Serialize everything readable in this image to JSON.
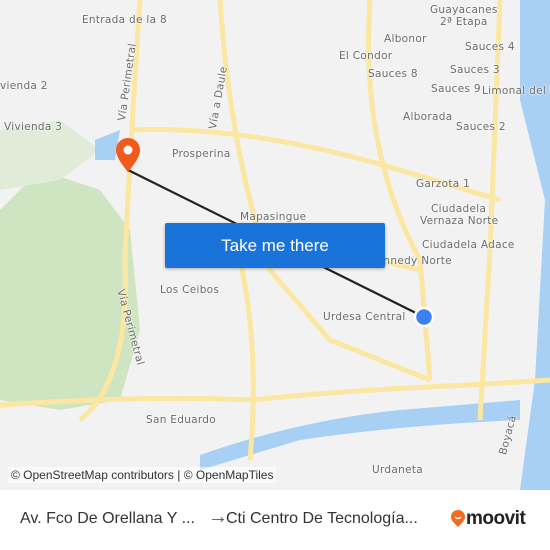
{
  "map": {
    "labels": {
      "entrada": "Entrada de la 8",
      "vivienda2": "vienda 2",
      "vivienda3": "Vivienda 3",
      "via_perimetral_1": "Vía Perimetral",
      "via_perimetral_2": "Vía Perimetral",
      "via_daule": "Vía a Daule",
      "prosperina": "Prosperina",
      "mapasingue": "Mapasingue",
      "los_ceibos": "Los Ceibos",
      "urdesa": "Urdesa Central",
      "san_eduardo": "San Eduardo",
      "urdaneta": "Urdaneta",
      "boyaca": "Boyacá",
      "guayacanes": "Guayacanes",
      "etapa": "2ª Etapa",
      "albonor": "Albonor",
      "el_condor": "El Condor",
      "sauces8": "Sauces 8",
      "sauces4": "Sauces 4",
      "sauces3": "Sauces 3",
      "sauces9": "Sauces 9",
      "limonal": "Limonal del R",
      "alborada": "Alborada",
      "sauces2": "Sauces 2",
      "garzota": "Garzota 1",
      "vernaza1": "Ciudadela",
      "vernaza2": "Vernaza Norte",
      "adace": "Ciudadela Adace",
      "kennedy": "Kennedy Norte"
    },
    "cta_label": "Take me there",
    "attribution": "© OpenStreetMap contributors | © OpenMapTiles",
    "colors": {
      "route": "#222222",
      "origin": "#3b82f0",
      "destination": "#f05a1a",
      "water": "#a8d0f5",
      "park": "#cfe5c2",
      "road": "#fbe7a1"
    }
  },
  "footer": {
    "from": "Av. Fco De Orellana Y ...",
    "arrow": "→",
    "to": "Cti Centro De Tecnología...",
    "brand": "moovit"
  }
}
